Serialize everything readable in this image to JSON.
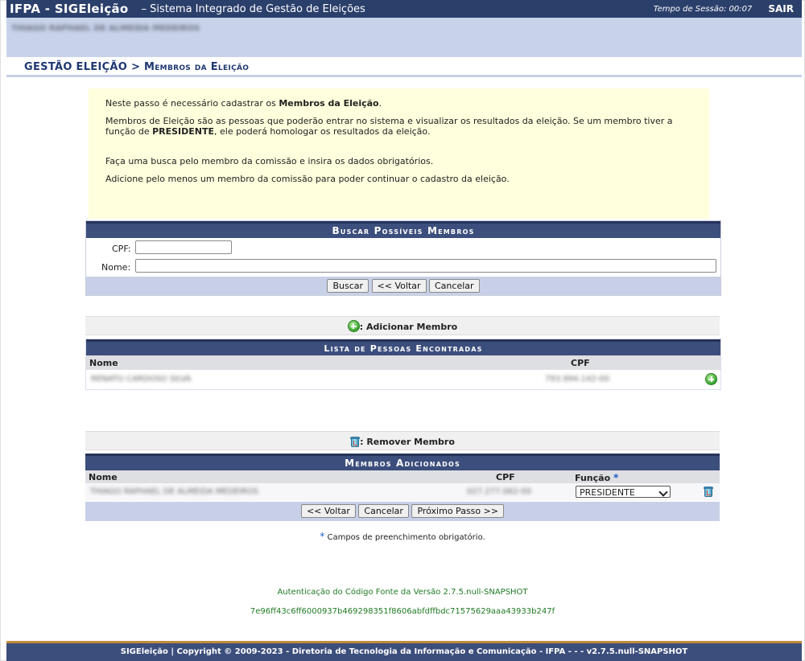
{
  "header": {
    "brand": "IFPA - SIGEleição",
    "subtitle": "– Sistema Integrado de Gestão de Eleições",
    "session_label": "Tempo de Sessão:",
    "session_time": "00:07",
    "logout": "SAIR",
    "username": "THIAGO RAPHAEL DE ALMEIDA MEDEIROS"
  },
  "breadcrumb": {
    "section": "GESTÃO ELEIÇÃO >",
    "page": "Membros da Eleição"
  },
  "info": {
    "p1_pre": "Neste passo é necessário cadastrar os ",
    "p1_bold": "Membros da Eleição",
    "p1_post": ".",
    "p2_pre": "Membros de Eleição são as pessoas que poderão entrar no sistema e visualizar os resultados da eleição. Se um membro tiver a função de ",
    "p2_bold": "PRESIDENTE",
    "p2_post": ", ele poderá homologar os resultados da eleição.",
    "p3": "Faça uma busca pelo membro da comissão e insira os dados obrigatórios.",
    "p4": "Adicione pelo menos um membro da comissão para poder continuar o cadastro da eleição."
  },
  "search": {
    "title": "Buscar Possíveis Membros",
    "cpf_label": "CPF:",
    "cpf_value": "",
    "name_label": "Nome:",
    "name_value": "",
    "buttons": {
      "search": "Buscar",
      "back": "<< Voltar",
      "cancel": "Cancelar"
    }
  },
  "add_legend": ": Adicionar Membro",
  "found": {
    "title": "Lista de Pessoas Encontradas",
    "col_name": "Nome",
    "col_cpf": "CPF",
    "rows": [
      {
        "name": "RENATO CARDOSO SILVA",
        "cpf": "793.994.142-00"
      }
    ]
  },
  "remove_legend": ": Remover Membro",
  "members": {
    "title": "Membros Adicionados",
    "col_name": "Nome",
    "col_cpf": "CPF",
    "col_role": "Função",
    "rows": [
      {
        "name": "THIAGO RAPHAEL DE ALMEIDA MEDEIROS",
        "cpf": "027.277.062-00",
        "role": "PRESIDENTE"
      }
    ],
    "buttons": {
      "back": "<< Voltar",
      "cancel": "Cancelar",
      "next": "Próximo Passo >>"
    }
  },
  "required_note": "Campos de preenchimento obrigatório.",
  "auth": {
    "line1": "Autenticação do Código Fonte da Versão 2.7.5.null-SNAPSHOT",
    "line2": "7e96ff43c6ff6000937b469298351f8606abfdffbdc71575629aaa43933b247f"
  },
  "footer": "SIGEleição | Copyright © 2009-2023 - Diretoria de Tecnologia da Informação e Comunicação - IFPA - - - v2.7.5.null-SNAPSHOT",
  "colors": {
    "header": "#2b3f6b",
    "caption": "#3c4e7c",
    "info_bg": "#ffffdd",
    "accent_footer": "#c38b3c"
  }
}
